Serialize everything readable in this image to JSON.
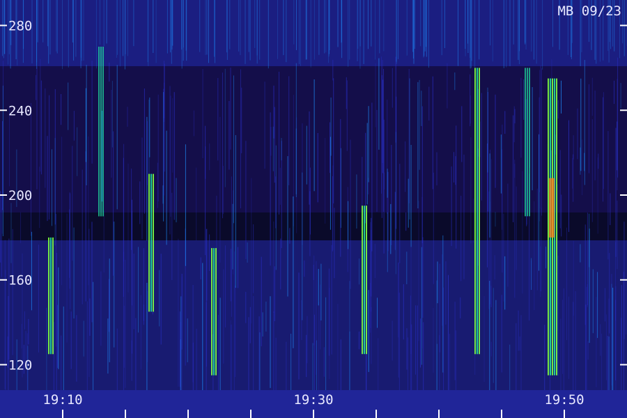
{
  "chart_data": {
    "type": "heatmap",
    "title": "",
    "xlabel": "",
    "ylabel": "",
    "corner_label": "MB 09/23",
    "x_ticks": [
      "19:10",
      "19:30",
      "19:50"
    ],
    "x_range_minutes": [
      "19:05",
      "19:55"
    ],
    "y_ticks": [
      120,
      160,
      200,
      240,
      280
    ],
    "y_range": [
      108,
      292
    ],
    "colormap": [
      "#0a0a2a",
      "#1a1060",
      "#2a30c8",
      "#1e90ff",
      "#20e0a0",
      "#7cff40",
      "#ff8020"
    ],
    "bright_events": [
      {
        "time": "19:09",
        "freq_low": 125,
        "freq_high": 180,
        "intensity": "medium"
      },
      {
        "time": "19:13",
        "freq_low": 190,
        "freq_high": 270,
        "intensity": "low"
      },
      {
        "time": "19:17",
        "freq_low": 145,
        "freq_high": 210,
        "intensity": "medium"
      },
      {
        "time": "19:22",
        "freq_low": 115,
        "freq_high": 175,
        "intensity": "medium"
      },
      {
        "time": "19:34",
        "freq_low": 125,
        "freq_high": 195,
        "intensity": "medium"
      },
      {
        "time": "19:43",
        "freq_low": 125,
        "freq_high": 260,
        "intensity": "medium"
      },
      {
        "time": "19:47",
        "freq_low": 190,
        "freq_high": 260,
        "intensity": "low"
      },
      {
        "time": "19:49",
        "freq_low": 115,
        "freq_high": 255,
        "intensity": "high"
      }
    ]
  }
}
